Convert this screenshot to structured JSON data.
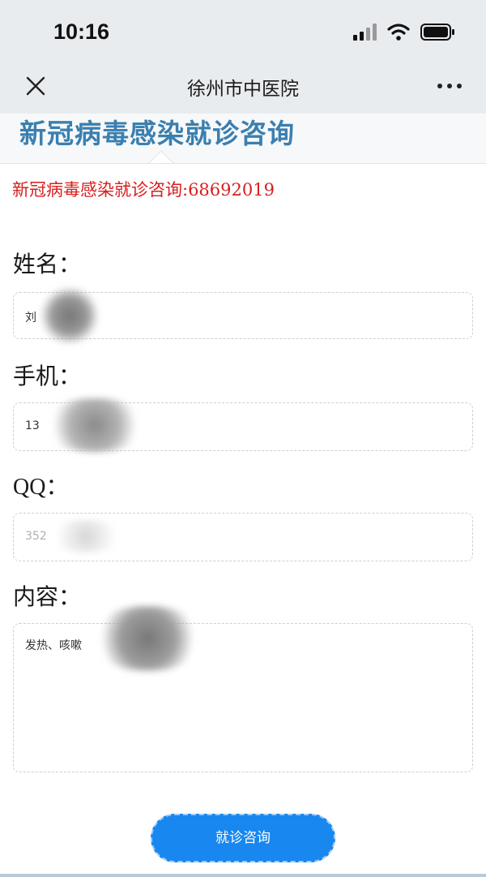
{
  "status_bar": {
    "time": "10:16",
    "icons": [
      "signal-icon",
      "wifi-icon",
      "battery-icon"
    ]
  },
  "nav": {
    "title": "徐州市中医院",
    "close_icon": "close-icon",
    "more_icon": "more-icon"
  },
  "page": {
    "heading": "新冠病毒感染就诊咨询",
    "phone_line": "新冠病毒感染就诊咨询:68692019"
  },
  "form": {
    "name": {
      "label": "姓名：",
      "value": "刘"
    },
    "mobile": {
      "label": "手机：",
      "value": "13"
    },
    "qq": {
      "label": "QQ：",
      "value": "352"
    },
    "content": {
      "label": "内容：",
      "value": "发热、咳嗽"
    },
    "submit_label": "就诊咨询"
  },
  "colors": {
    "heading": "#3a7fb0",
    "phone_line": "#d81e1e",
    "button": "#1887f0",
    "chrome_bg": "#e9ecef"
  }
}
